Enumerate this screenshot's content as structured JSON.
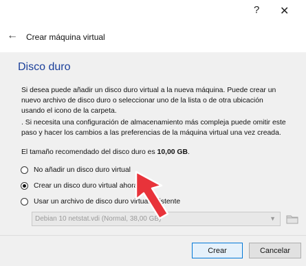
{
  "window": {
    "help_glyph": "?",
    "close_glyph": "✕"
  },
  "header": {
    "back_glyph": "←",
    "title": "Crear máquina virtual"
  },
  "section": {
    "title": "Disco duro",
    "paragraph1": "Si desea puede añadir un disco duro virtual a la nueva máquina. Puede crear un nuevo archivo de disco duro o seleccionar uno de la lista o de otra ubicación usando el icono de la carpeta.",
    "paragraph2": ". Si necesita una configuración de almacenamiento más compleja puede omitir este paso y hacer los cambios a las preferencias de la máquina virtual una vez creada.",
    "recommended_prefix": "El tamaño recomendado del disco duro es ",
    "recommended_size": "10,00 GB",
    "recommended_suffix": "."
  },
  "options": [
    {
      "label": "No añadir un disco duro virtual",
      "checked": false
    },
    {
      "label": "Crear un disco duro virtual ahora",
      "checked": true
    },
    {
      "label": "Usar un archivo de disco duro virtual existente",
      "checked": false
    }
  ],
  "disk_select": {
    "value": "Debian 10 netstat.vdi (Normal, 38,00 GB)",
    "enabled": false
  },
  "footer": {
    "create_label": "Crear",
    "cancel_label": "Cancelar"
  },
  "colors": {
    "section_title": "#1a3f9a",
    "annotation_arrow": "#e8333a",
    "primary_button_border": "#0078d7"
  },
  "icons": {
    "help": "question-mark-icon",
    "close": "close-icon",
    "back": "back-arrow-icon",
    "dropdown": "chevron-down-icon",
    "folder": "folder-icon",
    "annotation": "red-pointer-arrow-icon"
  }
}
